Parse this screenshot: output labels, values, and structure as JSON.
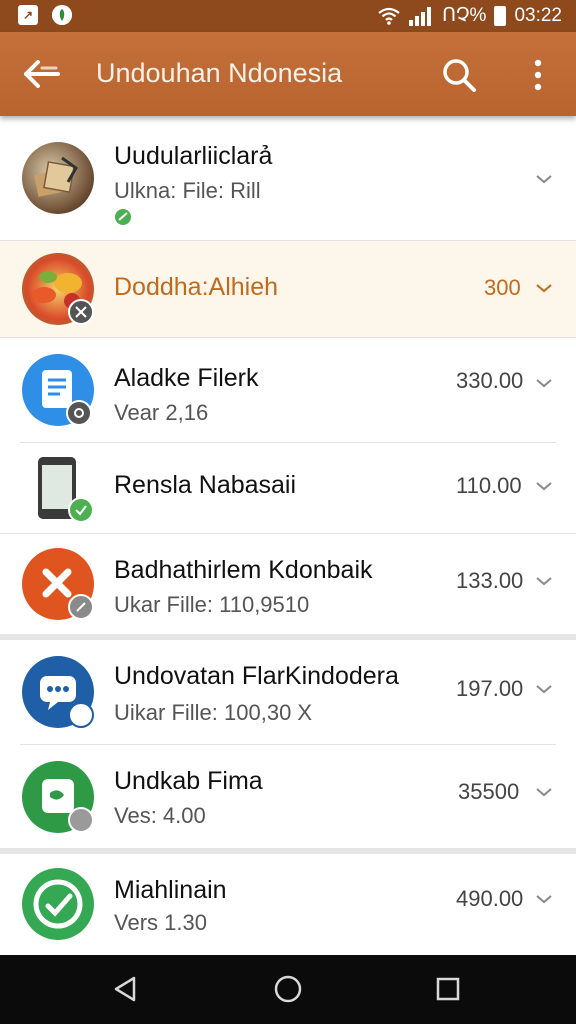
{
  "status_bar": {
    "left_icons": [
      "notification-icon",
      "whatsapp-icon"
    ],
    "carrier_text": "ՈՉ%",
    "time": "03:22"
  },
  "app_bar": {
    "title": "Undouhan Ndonesia",
    "back_icon": "arrow-back-icon",
    "search_icon": "search-icon",
    "more_icon": "more-vert-icon"
  },
  "items": [
    {
      "title": "Uudularliiclarả",
      "subtitle": "Ulkna: File: Rill",
      "value": "",
      "icon": "book-stack-icon"
    },
    {
      "title": "Doddha:Alhieh",
      "subtitle": "",
      "value": "300",
      "icon": "food-bowls-icon",
      "highlighted": true
    },
    {
      "title": "Aladke Filerk",
      "subtitle": "Vear 2,16",
      "value": "330.00",
      "icon": "document-icon"
    },
    {
      "title": "Rensla Nabasaii",
      "subtitle": "",
      "value": "110.00",
      "icon": "phone-screen-icon"
    },
    {
      "title": "Badhathirlem Kdonbaik",
      "subtitle": "Ukar Fille: 110,9510",
      "value": "133.00",
      "icon": "cross-logo-icon"
    },
    {
      "title": "Undovatan FlarKindodera",
      "subtitle": "Uikar Fille: 100,30 X",
      "value": "197.00",
      "icon": "chat-bubble-icon"
    },
    {
      "title": "Undkab Fima",
      "subtitle": "Ves: 4.00",
      "value": "35500",
      "icon": "green-card-icon"
    },
    {
      "title": "Miahlinain",
      "subtitle": "Vers 1.30",
      "value": "490.00",
      "icon": "check-leaf-icon"
    }
  ],
  "colors": {
    "status_bar": "#8e4a1c",
    "app_bar": "#c0692f",
    "accent": "#c06a1d",
    "highlight_row": "#fdf6ea"
  },
  "nav": [
    "back-triangle-icon",
    "home-circle-icon",
    "recents-square-icon"
  ]
}
